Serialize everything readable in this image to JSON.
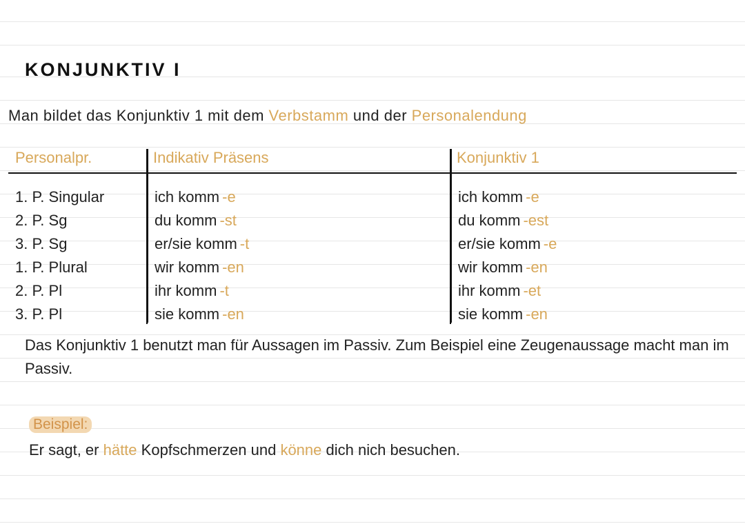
{
  "title": "KONJUNKTIV I",
  "intro": {
    "pre": "Man bildet das Konjunktiv 1 mit dem ",
    "hl1": "Verbstamm",
    "mid": " und der ",
    "hl2": "Personalendung"
  },
  "table": {
    "headers": {
      "c0": "Personalpr.",
      "c1": "Indikativ Präsens",
      "c2": "Konjunktiv 1"
    },
    "rows": [
      {
        "pp": "1. P. Singular",
        "ind_base": "ich komm",
        "ind_suf": "-e",
        "kon_base": "ich komm",
        "kon_suf": "-e"
      },
      {
        "pp": "2. P. Sg",
        "ind_base": "du komm",
        "ind_suf": "-st",
        "kon_base": "du komm",
        "kon_suf": "-est"
      },
      {
        "pp": "3. P. Sg",
        "ind_base": "er/sie komm",
        "ind_suf": "-t",
        "kon_base": "er/sie komm",
        "kon_suf": "-e"
      },
      {
        "pp": "1. P. Plural",
        "ind_base": "wir komm",
        "ind_suf": "-en",
        "kon_base": "wir komm",
        "kon_suf": "-en"
      },
      {
        "pp": "2. P. Pl",
        "ind_base": "ihr komm",
        "ind_suf": "-t",
        "kon_base": "ihr komm",
        "kon_suf": "-et"
      },
      {
        "pp": "3. P. Pl",
        "ind_base": "sie komm",
        "ind_suf": "-en",
        "kon_base": "sie komm",
        "kon_suf": "-en"
      }
    ]
  },
  "explain": "Das Konjunktiv 1 benutzt man für Aussagen im Passiv. Zum Beispiel eine Zeugen­aussage macht man im Passiv.",
  "example_label": "Beispiel:",
  "example": {
    "a": "Er sagt, er ",
    "h1": "hätte",
    "b": " Kopfschmerzen und ",
    "h2": "könne",
    "c": " dich nich besuchen."
  }
}
